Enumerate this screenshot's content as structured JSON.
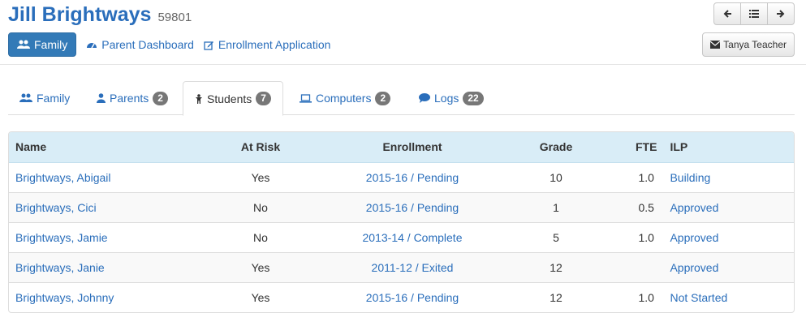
{
  "header": {
    "title": "Jill Brightways",
    "record_id": "59801"
  },
  "nav": {
    "prev_icon": "arrow-left-icon",
    "list_icon": "list-icon",
    "next_icon": "arrow-right-icon"
  },
  "toolbar": {
    "family_label": "Family",
    "parent_dashboard_label": "Parent Dashboard",
    "enrollment_application_label": "Enrollment Application",
    "teacher_label": "Tanya Teacher"
  },
  "tabs": [
    {
      "label": "Family",
      "badge": ""
    },
    {
      "label": "Parents",
      "badge": "2"
    },
    {
      "label": "Students",
      "badge": "7"
    },
    {
      "label": "Computers",
      "badge": "2"
    },
    {
      "label": "Logs",
      "badge": "22"
    }
  ],
  "table": {
    "headers": [
      "Name",
      "At Risk",
      "Enrollment",
      "Grade",
      "FTE",
      "ILP"
    ],
    "rows": [
      [
        "Brightways, Abigail",
        "Yes",
        "2015-16 / Pending",
        "10",
        "1.0",
        "Building"
      ],
      [
        "Brightways, Cici",
        "No",
        "2015-16 / Pending",
        "1",
        "0.5",
        "Approved"
      ],
      [
        "Brightways, Jamie",
        "No",
        "2013-14 / Complete",
        "5",
        "1.0",
        "Approved"
      ],
      [
        "Brightways, Janie",
        "Yes",
        "2011-12 / Exited",
        "12",
        "",
        "Approved"
      ],
      [
        "Brightways, Johnny",
        "Yes",
        "2015-16 / Pending",
        "12",
        "1.0",
        "Not Started"
      ]
    ]
  },
  "colors": {
    "link": "#2a6ebb",
    "primary": "#337ab7",
    "header_bg": "#d9edf7",
    "badge": "#777777"
  }
}
